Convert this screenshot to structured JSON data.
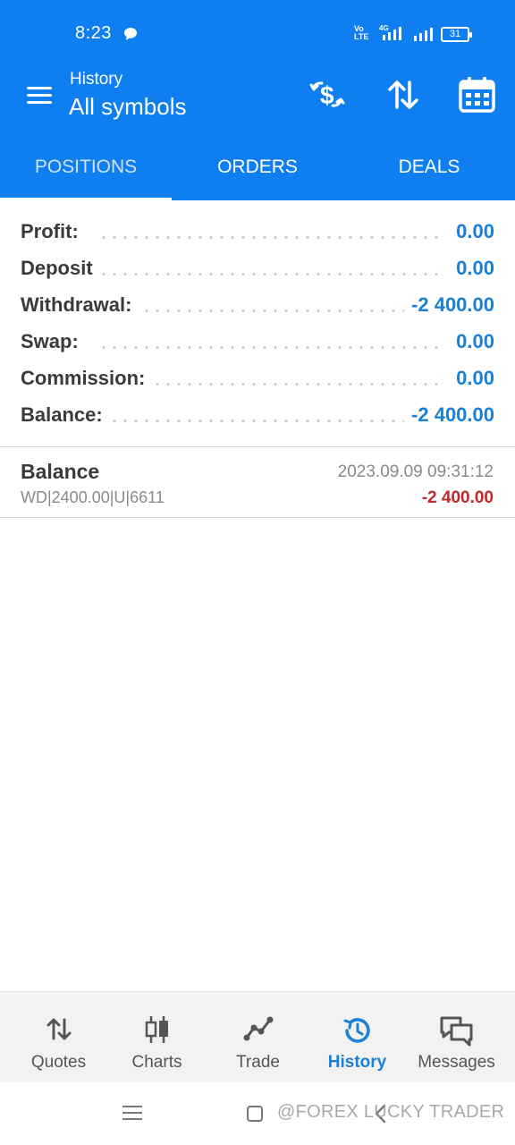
{
  "status_bar": {
    "time": "8:23",
    "network": "4G",
    "volte": "Vo\nLTE",
    "battery": "31"
  },
  "app_bar": {
    "subtitle": "History",
    "title": "All symbols",
    "actions": [
      "currency-exchange-icon",
      "sort-icon",
      "calendar-icon"
    ]
  },
  "tabs": [
    {
      "label": "POSITIONS",
      "active": true
    },
    {
      "label": "ORDERS",
      "active": false
    },
    {
      "label": "DEALS",
      "active": false
    }
  ],
  "summary": [
    {
      "label": "Profit:",
      "value": "0.00"
    },
    {
      "label": "Deposit",
      "value": "0.00"
    },
    {
      "label": "Withdrawal:",
      "value": "-2 400.00"
    },
    {
      "label": "Swap:",
      "value": "0.00"
    },
    {
      "label": "Commission:",
      "value": "0.00"
    },
    {
      "label": "Balance:",
      "value": "-2 400.00"
    }
  ],
  "deals": [
    {
      "name": "Balance",
      "datetime": "2023.09.09 09:31:12",
      "comment": "WD|2400.00|U|6611",
      "amount": "-2 400.00"
    }
  ],
  "bottom_nav": [
    {
      "label": "Quotes",
      "icon": "quotes-arrows-icon",
      "active": false
    },
    {
      "label": "Charts",
      "icon": "candlestick-icon",
      "active": false
    },
    {
      "label": "Trade",
      "icon": "trade-line-icon",
      "active": false
    },
    {
      "label": "History",
      "icon": "history-clock-icon",
      "active": true
    },
    {
      "label": "Messages",
      "icon": "messages-icon",
      "active": false
    }
  ],
  "watermark": "@FOREX LUCKY TRADER",
  "colors": {
    "primary": "#0f7ef0",
    "value_blue": "#1a7fd6",
    "negative_red": "#c0282a"
  }
}
